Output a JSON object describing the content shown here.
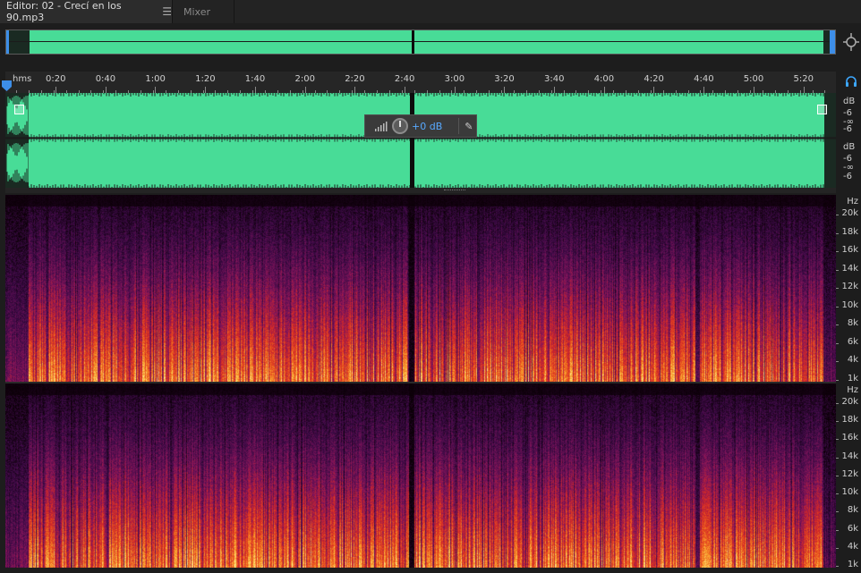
{
  "tabs": {
    "editor_label": "Editor: 02 - Crecí en los 90.mp3",
    "editor_menu_icon": "hamburger-icon",
    "mixer_label": "Mixer"
  },
  "ruler": {
    "unit": "hms",
    "labels": [
      "0:20",
      "0:40",
      "1:00",
      "1:20",
      "1:40",
      "2:00",
      "2:20",
      "2:40",
      "3:00",
      "3:20",
      "3:40",
      "4:00",
      "4:20",
      "4:40",
      "5:00",
      "5:20"
    ]
  },
  "hud": {
    "volume_value": "+0 dB",
    "knob_icon": "volume-knob-icon",
    "meter_icon": "level-meter-icon",
    "pin_icon": "pin-icon"
  },
  "db_scale": {
    "ch1": {
      "unit": "dB",
      "a": "-6",
      "b": "-∞",
      "c": "-6"
    },
    "ch2": {
      "unit": "dB",
      "a": "-6",
      "b": "-∞",
      "c": "-6"
    }
  },
  "hz_scale": {
    "unit": "Hz",
    "labels": [
      "20k",
      "18k",
      "16k",
      "14k",
      "12k",
      "10k",
      "8k",
      "6k",
      "4k",
      "1k"
    ]
  },
  "colors": {
    "waveform": "#48dc97",
    "accent": "#58a9ff",
    "spectral_low": "#ffe27a",
    "spectral_mid": "#e8361c",
    "spectral_high": "#5a1560"
  }
}
